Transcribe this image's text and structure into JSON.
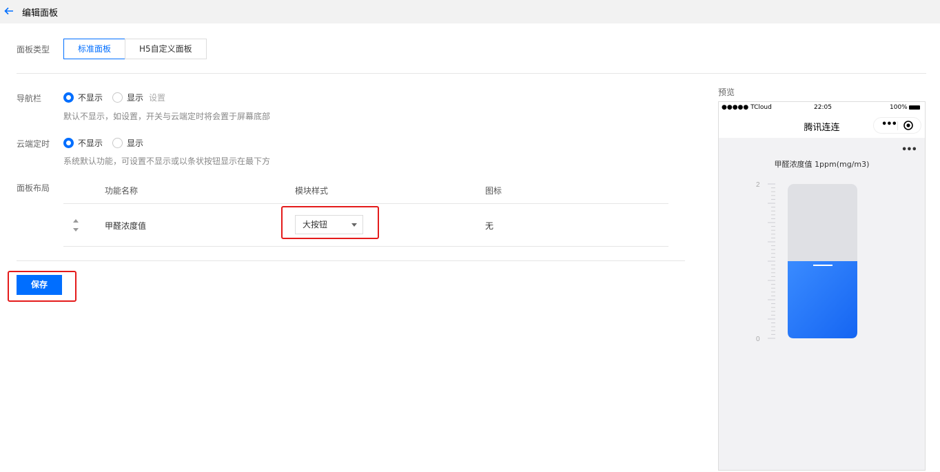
{
  "header": {
    "title": "编辑面板"
  },
  "panel_type": {
    "label": "面板类型",
    "options": [
      "标准面板",
      "H5自定义面板"
    ],
    "selected": "标准面板"
  },
  "navbar": {
    "label": "导航栏",
    "opt_hide": "不显示",
    "opt_show": "显示",
    "settings_link": "设置",
    "selected": "不显示",
    "hint": "默认不显示，如设置，开关与云端定时将会置于屏幕底部"
  },
  "cloud_timer": {
    "label": "云端定时",
    "opt_hide": "不显示",
    "opt_show": "显示",
    "selected": "不显示",
    "hint": "系统默认功能，可设置不显示或以条状按钮显示在最下方"
  },
  "layout": {
    "label": "面板布局",
    "columns": [
      "功能名称",
      "模块样式",
      "图标"
    ],
    "rows": [
      {
        "name": "甲醛浓度值",
        "style": "大按钮",
        "icon": "无"
      }
    ]
  },
  "save_label": "保存",
  "preview": {
    "label": "预览",
    "status_carrier": "●●●●● TCloud",
    "status_time": "22:05",
    "status_battery": "100%",
    "nav_title": "腾讯连连",
    "capsule_more": "•••",
    "more": "•••",
    "metric_title": "甲醛浓度值 1ppm(mg/m3)",
    "scale_max": "2",
    "scale_min": "0",
    "gauge_fill_fraction": 0.5,
    "accent": "#006eff"
  }
}
